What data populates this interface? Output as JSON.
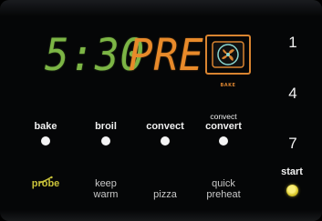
{
  "display": {
    "time": "5:30",
    "status": "PRE",
    "bake_caption": "BAKE",
    "time_color": "#7cb545",
    "status_color": "#e88a2a",
    "icon": "convection-fan-icon"
  },
  "numbers": [
    "1",
    "4",
    "7"
  ],
  "keys": {
    "bake": "bake",
    "broil": "broil",
    "convect": "convect",
    "convect_convert_top": "convect",
    "convect_convert_bottom": "convert"
  },
  "lower_keys": {
    "probe": "probe",
    "keep_warm_1": "keep",
    "keep_warm_2": "warm",
    "pizza": "pizza",
    "quick_preheat_1": "quick",
    "quick_preheat_2": "preheat"
  },
  "start": {
    "label": "start",
    "indicator_color": "#e6d43a"
  }
}
